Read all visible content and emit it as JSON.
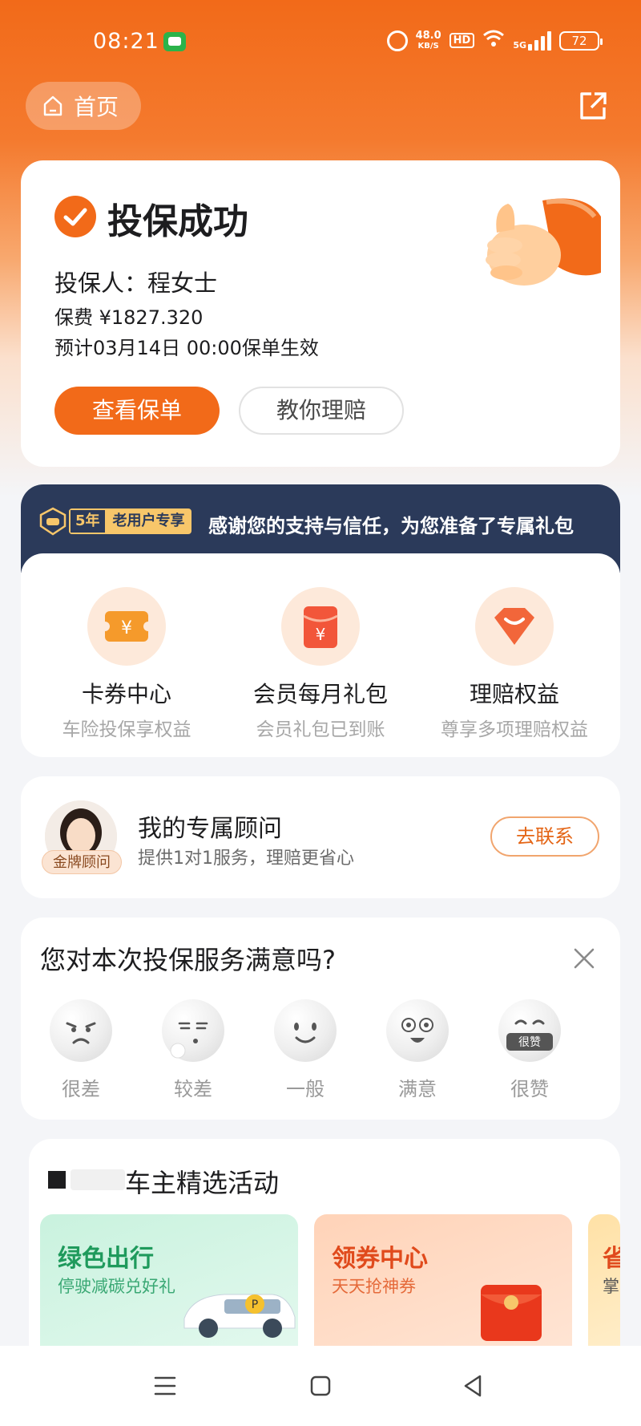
{
  "status_bar": {
    "time": "08:21",
    "net_speed_value": "48.0",
    "net_speed_unit": "KB/S",
    "hd": "HD",
    "network": "5G",
    "battery": "72"
  },
  "header": {
    "home_label": "首页"
  },
  "success": {
    "title": "投保成功",
    "insured": "投保人：程女士",
    "premium": "保费 ¥1827.320",
    "effective": "预计03月14日 00:00保单生效",
    "view_policy": "查看保单",
    "claim_guide": "教你理赔"
  },
  "benefits_banner": {
    "years": "5年",
    "tag": "老用户专享",
    "text": "感谢您的支持与信任，为您准备了专属礼包"
  },
  "benefits": [
    {
      "title": "卡券中心",
      "subtitle": "车险投保享权益",
      "icon": "ticket-icon"
    },
    {
      "title": "会员每月礼包",
      "subtitle": "会员礼包已到账",
      "icon": "red-packet-icon"
    },
    {
      "title": "理赔权益",
      "subtitle": "尊享多项理赔权益",
      "icon": "diamond-icon"
    }
  ],
  "advisor": {
    "badge": "金牌顾问",
    "title": "我的专属顾问",
    "subtitle": "提供1对1服务，理赔更省心",
    "contact": "去联系"
  },
  "survey": {
    "title": "您对本次投保服务满意吗?",
    "options": [
      {
        "label": "很差"
      },
      {
        "label": "较差"
      },
      {
        "label": "一般"
      },
      {
        "label": "满意"
      },
      {
        "label": "很赞",
        "badge": "很赞"
      }
    ]
  },
  "activities": {
    "title": "车主精选活动",
    "tiles": [
      {
        "title": "绿色出行",
        "subtitle": "停驶减碳兑好礼"
      },
      {
        "title": "领券中心",
        "subtitle": "天天抢神券"
      },
      {
        "title": "省",
        "subtitle": "掌"
      }
    ]
  },
  "colors": {
    "brand_orange": "#f26a19",
    "banner_navy": "#2b3a5a"
  }
}
